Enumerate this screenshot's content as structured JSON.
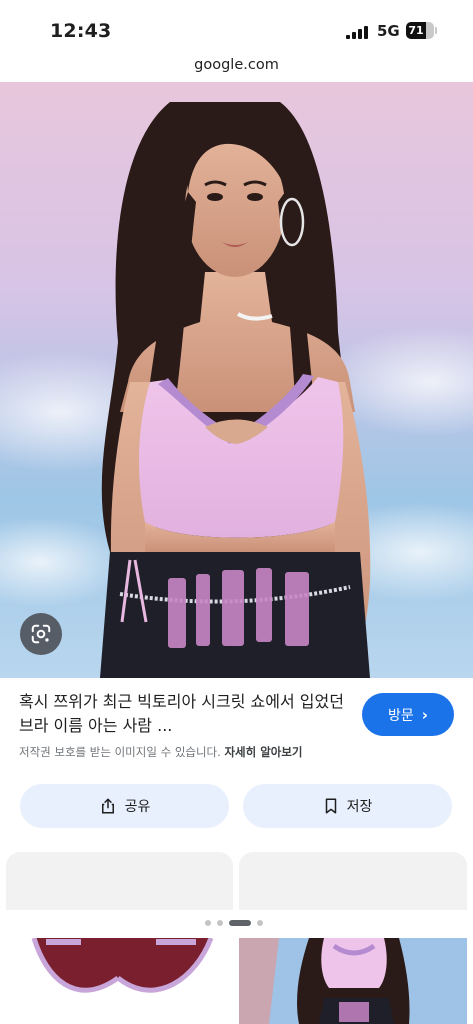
{
  "status_bar": {
    "time": "12:43",
    "network": "5G",
    "battery_percent": "71"
  },
  "browser": {
    "url": "google.com"
  },
  "result": {
    "title": "혹시 쯔위가 최근 빅토리아 시크릿 쇼에서 입었던 브라 이름 아는 사람 ...",
    "copyright_notice": "저작권 보호를 받는 이미지일 수 있습니다.",
    "learn_more": "자세히 알아보기",
    "visit_label": "방문",
    "share_label": "공유",
    "save_label": "저장"
  },
  "icons": {
    "lens": "google-lens-icon",
    "share": "share-icon",
    "save": "bookmark-icon",
    "visit": "chevron-right-icon"
  },
  "colors": {
    "accent": "#1a73e8",
    "button_bg": "#e8f0fe",
    "top_pink": "#e6b8e2",
    "lace_purple": "#b48ad0",
    "secondary_text": "#70757a"
  }
}
